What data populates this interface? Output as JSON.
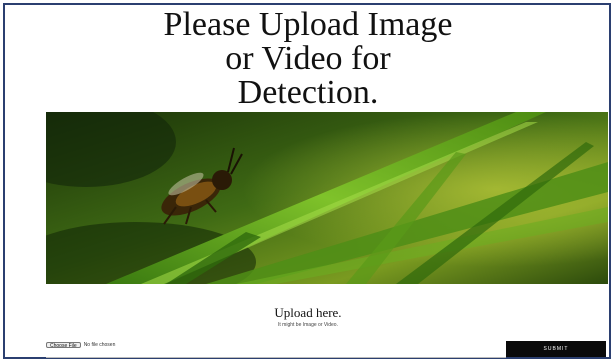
{
  "page": {
    "title_lines": [
      "Please Upload Image",
      "or Video for",
      "Detection."
    ]
  },
  "hero": {
    "icon": "nature-photo-bee-on-grass"
  },
  "upload": {
    "heading": "Upload here.",
    "subtext": "It might be Image or Video.",
    "choose_file_label": "Choose File",
    "file_status": "No file chosen",
    "submit_label": "SUBMIT"
  },
  "colors": {
    "frame_border": "#2b3f70",
    "submit_bg": "#0a0a0a",
    "submit_text": "#ffffff"
  }
}
